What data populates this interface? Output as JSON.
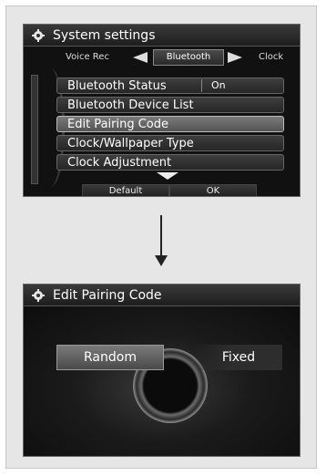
{
  "screen1": {
    "title": "System settings",
    "tabs": {
      "left": "Voice Rec",
      "active": "Bluetooth",
      "right": "Clock"
    },
    "menu": [
      {
        "label": "Bluetooth Status",
        "value": "On"
      },
      {
        "label": "Bluetooth Device List"
      },
      {
        "label": "Edit Pairing Code",
        "selected": true
      },
      {
        "label": "Clock/Wallpaper Type"
      },
      {
        "label": "Clock Adjustment"
      }
    ],
    "softkeys": {
      "left": "Default",
      "right": "OK"
    }
  },
  "screen2": {
    "title": "Edit Pairing Code",
    "options": {
      "random": "Random",
      "fixed": "Fixed"
    },
    "selected": "Random"
  },
  "icons": {
    "title_icon": "gear-icon",
    "transition": "down-arrow-icon"
  }
}
